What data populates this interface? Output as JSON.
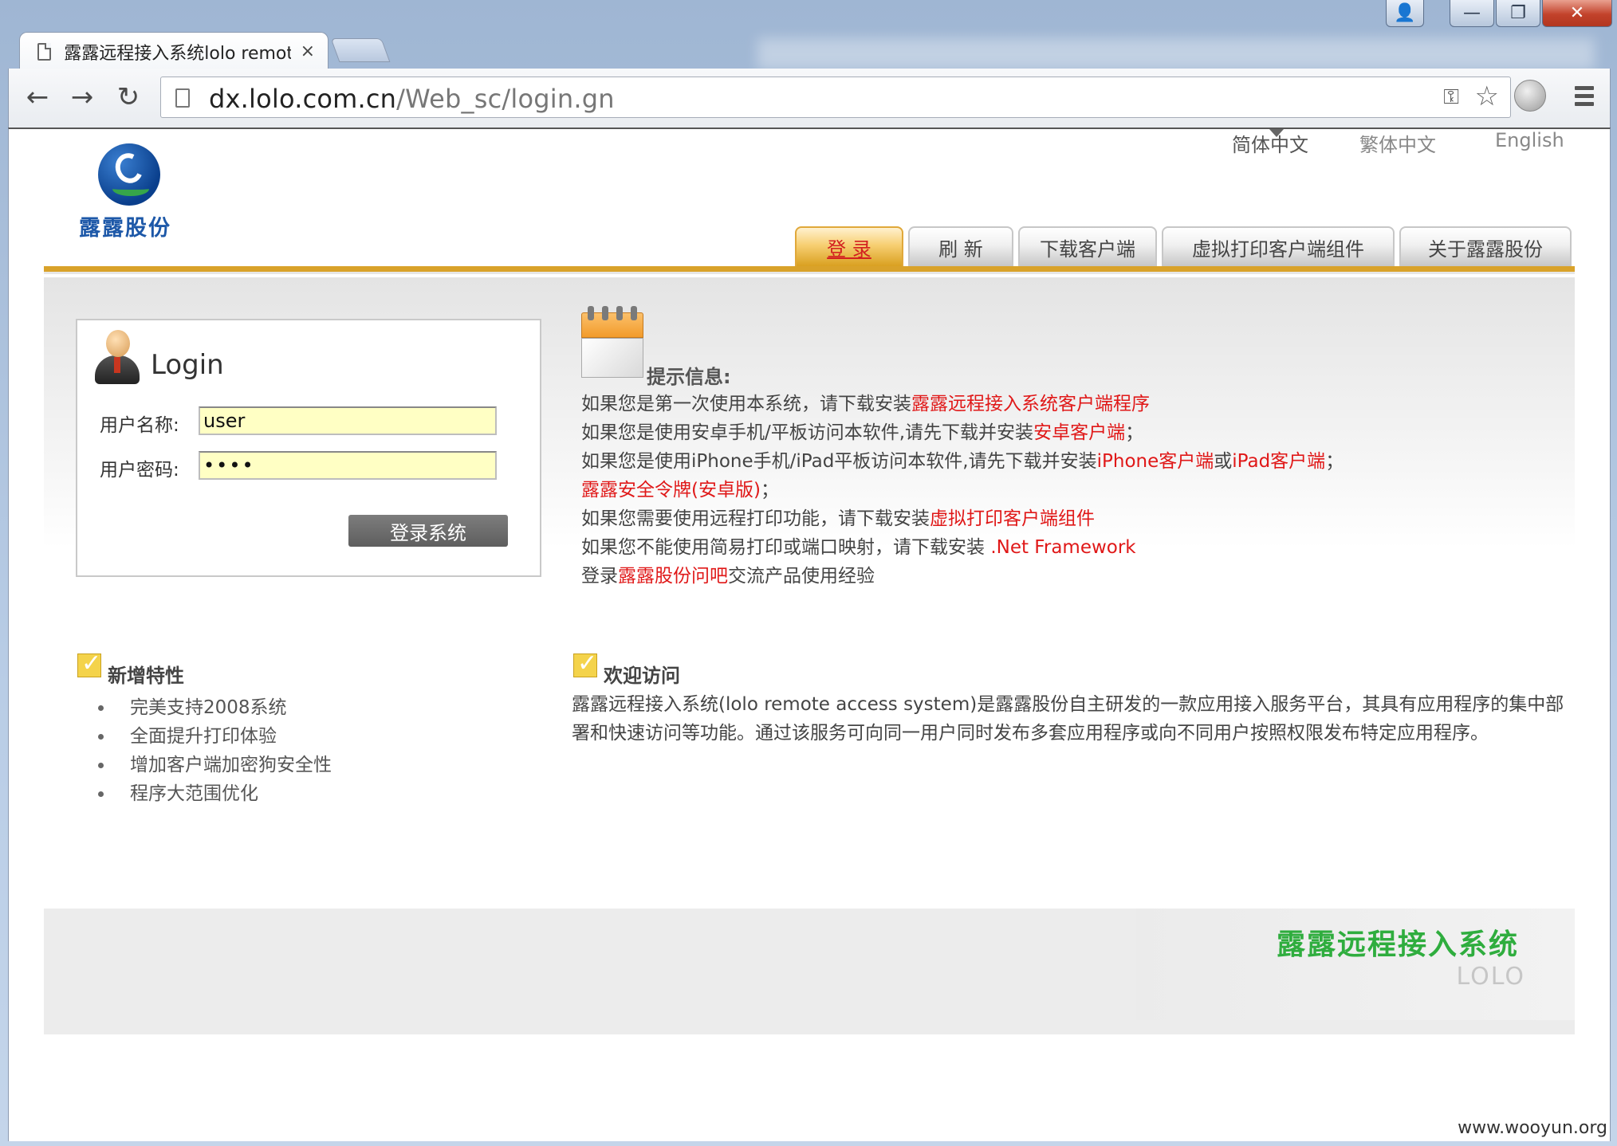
{
  "window": {
    "controls": {
      "user": "👤",
      "minimize": "—",
      "maximize": "❐",
      "close": "✕"
    }
  },
  "browser": {
    "tab_title": "露露远程接入系统lolo remote",
    "tab_close": "×",
    "url_host": "dx.lolo.com.cn",
    "url_path": "/Web_sc/login.gn",
    "icons": [
      "page-icon",
      "key-icon",
      "star-icon",
      "globe-icon",
      "menu-icon"
    ],
    "nav": {
      "back": "←",
      "forward": "→",
      "reload": "↻"
    },
    "key_glyph": "⚿",
    "star_glyph": "☆"
  },
  "header": {
    "logo_text": "露露股份",
    "languages": [
      "简体中文",
      "繁体中文",
      "English"
    ],
    "nav_tabs": [
      "登 录",
      "刷 新",
      "下载客户端",
      "虚拟打印客户端组件",
      "关于露露股份"
    ]
  },
  "login": {
    "title": "Login",
    "username_label": "用户名称:",
    "username_value": "user",
    "password_label": "用户密码:",
    "password_mask": "••••",
    "submit_label": "登录系统"
  },
  "tips": {
    "heading": "提示信息:",
    "lines": [
      {
        "pre": "如果您是第一次使用本系统，请下载安装",
        "link": "露露远程接入系统客户端程序",
        "post": ""
      },
      {
        "pre": "如果您是使用安卓手机/平板访问本软件,请先下载并安装",
        "link": "安卓客户端",
        "post": "；"
      },
      {
        "pre": "如果您是使用iPhone手机/iPad平板访问本软件,请先下载并安装",
        "link": "iPhone客户端",
        "mid": "或",
        "link2": "iPad客户端",
        "post": "；"
      },
      {
        "pre": "",
        "link": "露露安全令牌(安卓版)",
        "post": "；"
      },
      {
        "pre": "如果您需要使用远程打印功能，请下载安装",
        "link": "虚拟打印客户端组件",
        "post": ""
      },
      {
        "pre": "如果您不能使用简易打印或端口映射，请下载安装 ",
        "link": ".Net Framework",
        "post": ""
      },
      {
        "pre": "登录",
        "link": "露露股份问吧",
        "post": "交流产品使用经验"
      }
    ]
  },
  "features": {
    "heading": "新增特性",
    "items": [
      "完美支持2008系统",
      "全面提升打印体验",
      "增加客户端加密狗安全性",
      "程序大范围优化"
    ]
  },
  "welcome": {
    "heading": "欢迎访问",
    "body": "露露远程接入系统(lolo remote access system)是露露股份自主研发的一款应用接入服务平台，其具有应用程序的集中部署和快速访问等功能。通过该服务可向同一用户同时发布多套应用程序或向不同用户按照权限发布特定应用程序。"
  },
  "footer": {
    "title": "露露远程接入系统",
    "subtitle": "LOLO"
  },
  "watermark": "www.wooyun.org",
  "colors": {
    "accent_gold": "#d9a22a",
    "link_red": "#e01818",
    "brand_blue": "#1d58a8",
    "brand_green": "#2fad3e"
  }
}
